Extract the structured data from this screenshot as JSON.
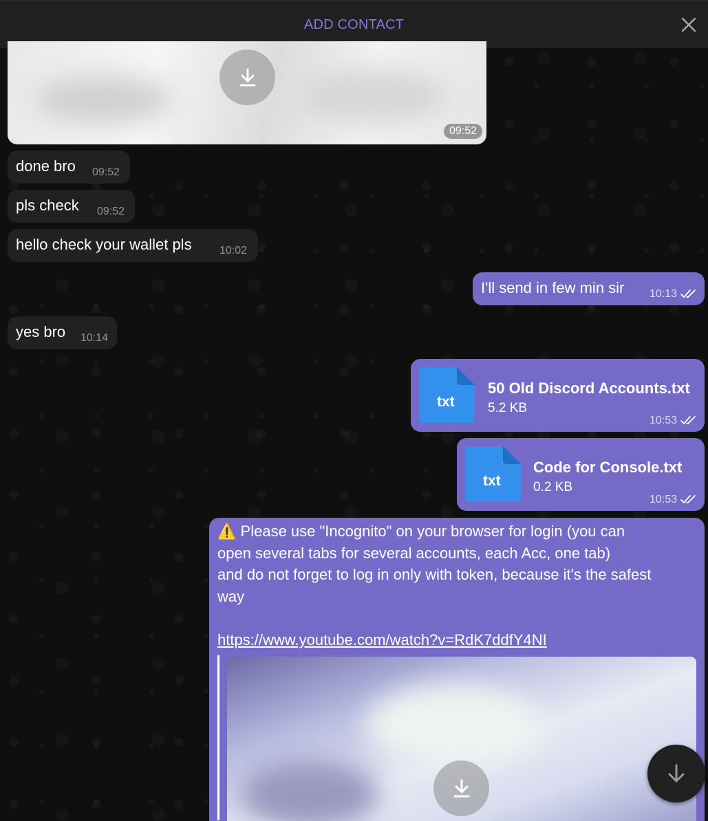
{
  "header": {
    "title": "ADD CONTACT",
    "close_icon": "close-icon"
  },
  "colors": {
    "accent": "#8774e1",
    "outgoing_bubble": "#766ac8",
    "incoming_bubble": "#212121",
    "file_icon": "#3390ec"
  },
  "messages": [
    {
      "type": "image",
      "direction": "incoming",
      "time": "09:52"
    },
    {
      "type": "text",
      "direction": "incoming",
      "text": "done bro",
      "time": "09:52"
    },
    {
      "type": "text",
      "direction": "incoming",
      "text": "pls check",
      "time": "09:52"
    },
    {
      "type": "text",
      "direction": "incoming",
      "text": "hello check your wallet pls",
      "time": "10:02"
    },
    {
      "type": "text",
      "direction": "outgoing",
      "text": "I'll send in few min sir",
      "time": "10:13",
      "status": "read"
    },
    {
      "type": "text",
      "direction": "incoming",
      "text": "yes bro",
      "time": "10:14"
    },
    {
      "type": "file",
      "direction": "outgoing",
      "ext": "txt",
      "name": "50 Old Discord Accounts.txt",
      "size": "5.2 KB",
      "time": "10:53",
      "status": "read"
    },
    {
      "type": "file",
      "direction": "outgoing",
      "ext": "txt",
      "name": "Code for Console.txt",
      "size": "0.2 KB",
      "time": "10:53",
      "status": "read"
    },
    {
      "type": "text_with_preview",
      "direction": "outgoing",
      "emoji": "⚠️",
      "line1": "Please use \"Incognito\" on your browser for login (you can",
      "line2": "open several tabs for several accounts, each Acc, one tab)",
      "line3": "and do not forget to log in only with token, because it's the safest",
      "line4": "way",
      "link": "https://www.youtube.com/watch?v=RdK7ddfY4NI"
    }
  ]
}
